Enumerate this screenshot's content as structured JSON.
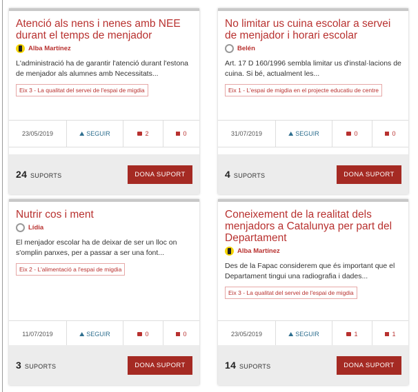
{
  "cards": [
    {
      "title": "Atenció als nens i nenes amb NEE durant el temps de menjador",
      "author": "Alba Martínez",
      "excerpt": "L'administració ha de garantir l'atenció durant l'estona de menjador als alumnes amb Necessitats...",
      "tag": "Eix 3 - La qualitat del servei de l'espai de migdia",
      "date": "23/05/2019",
      "follow_label": "SEGUIR",
      "comments": "2",
      "votes": "0",
      "supports_count": "24",
      "supports_label": "SUPORTS",
      "button_label": "DONA SUPORT"
    },
    {
      "title": "No limitar us cuina escolar a servei de menjador i horari escolar",
      "author": "Belén",
      "excerpt": "Art. 17 D 160/1996 sembla limitar us d'instal·lacions de cuina. Si bé, actualment les...",
      "tag": "Eix 1 - L'espai de migdia en el projecte educatiu de centre",
      "date": "31/07/2019",
      "follow_label": "SEGUIR",
      "comments": "0",
      "votes": "0",
      "supports_count": "4",
      "supports_label": "SUPORTS",
      "button_label": "DONA SUPORT"
    },
    {
      "title": "Nutrir cos i ment",
      "author": "Lídia",
      "excerpt": "El menjador escolar ha de deixar de ser un lloc on s'omplin panxes, per a passar a ser una font...",
      "tag": "Eix 2 - L'alimentació a l'espai de migdia",
      "date": "11/07/2019",
      "follow_label": "SEGUIR",
      "comments": "0",
      "votes": "0",
      "supports_count": "3",
      "supports_label": "SUPORTS",
      "button_label": "DONA SUPORT"
    },
    {
      "title": "Coneixement de la realitat dels menjadors a Catalunya per part del Departament",
      "author": "Alba Martínez",
      "excerpt": "Des de la Fapac considerem que és important que el Departament tingui una radiografia i dades...",
      "tag": "Eix 3 - La qualitat del servei de l'espai de migdia",
      "date": "23/05/2019",
      "follow_label": "SEGUIR",
      "comments": "1",
      "votes": "1",
      "supports_count": "14",
      "supports_label": "SUPORTS",
      "button_label": "DONA SUPORT"
    }
  ],
  "colors": {
    "accent": "#b8312f",
    "button": "#a52a23",
    "follow": "#2f6f8f",
    "avatar_user": "#f4d400"
  }
}
